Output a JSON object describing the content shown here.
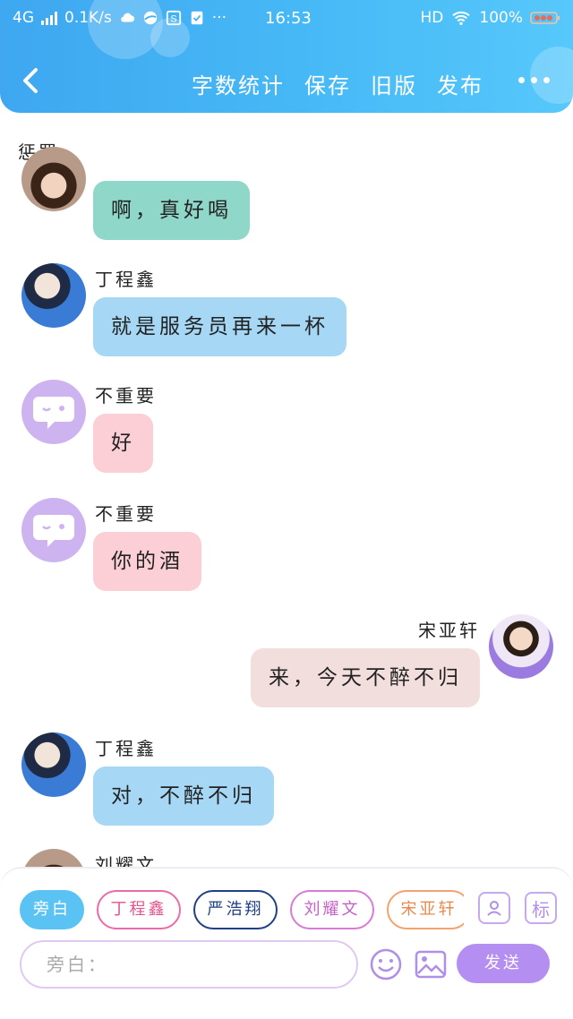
{
  "status_bar": {
    "network": "4G",
    "speed": "0.1K/s",
    "time": "16:53",
    "hd": "HD",
    "battery": "100%"
  },
  "header": {
    "actions": [
      "字数统计",
      "保存",
      "旧版",
      "发布"
    ]
  },
  "intro_text": "惩罚，",
  "messages": [
    {
      "speaker": "",
      "text": "啊，真好喝",
      "side": "left",
      "color": "#8fd8c9"
    },
    {
      "speaker": "丁程鑫",
      "text": "就是服务员再来一杯",
      "side": "left",
      "color": "#a6d8f6"
    },
    {
      "speaker": "不重要",
      "text": "好",
      "side": "left",
      "color": "#fccfd7"
    },
    {
      "speaker": "不重要",
      "text": "你的酒",
      "side": "left",
      "color": "#fccfd7"
    },
    {
      "speaker": "宋亚轩",
      "text": "来，今天不醉不归",
      "side": "right",
      "color": "#f2dedd"
    },
    {
      "speaker": "丁程鑫",
      "text": "对，不醉不归",
      "side": "left",
      "color": "#a6d8f6"
    },
    {
      "speaker": "刘耀文",
      "text": "",
      "side": "left"
    }
  ],
  "role_chips": [
    {
      "label": "旁白",
      "color": "#5bc3f3",
      "selected": true
    },
    {
      "label": "丁程鑫",
      "color": "#ec6aa6"
    },
    {
      "label": "严浩翔",
      "color": "#1f3f86"
    },
    {
      "label": "刘耀文",
      "color": "#d77ad8"
    },
    {
      "label": "宋亚轩",
      "color": "#f3a36b"
    }
  ],
  "tools": {
    "mark_label": "标"
  },
  "input": {
    "placeholder": "旁白："
  },
  "send_label": "发送"
}
